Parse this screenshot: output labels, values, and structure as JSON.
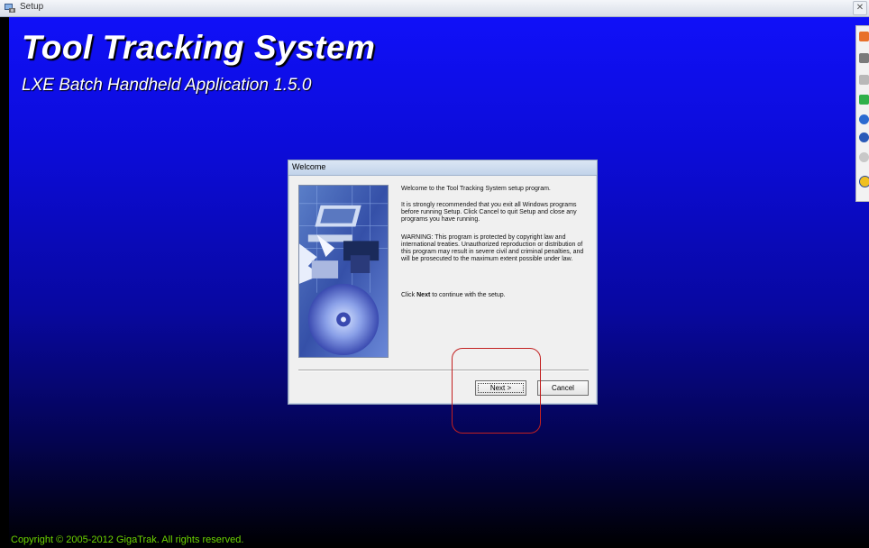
{
  "window": {
    "title": "Setup",
    "close_glyph": "✕"
  },
  "banner": {
    "title": "Tool Tracking System",
    "subtitle": "LXE Batch Handheld Application 1.5.0"
  },
  "copyright": "Copyright © 2005-2012 GigaTrak. All rights reserved.",
  "dialog": {
    "title": "Welcome",
    "intro": "Welcome to the Tool Tracking System setup program.",
    "recommend": "It is strongly recommended that you exit all Windows programs before running Setup.  Click Cancel to quit Setup and close any programs you have running.",
    "warning": "WARNING: This program is protected by copyright law and international treaties.  Unauthorized reproduction or distribution of this program may result in severe civil and criminal penalties, and will be prosecuted to the maximum extent possible under law.",
    "continue_prefix": "Click ",
    "continue_bold": "Next",
    "continue_suffix": " to continue with the setup.",
    "next_label": "Next >",
    "cancel_label": "Cancel"
  },
  "toolbar_icons": [
    "orange-icon",
    "gray-icon",
    "gray-icon",
    "green-icon",
    "blue-icon",
    "blue-icon",
    "gray-icon",
    "yellow-icon"
  ],
  "colors": {
    "copyright": "#6cd400",
    "annotation": "#c22020"
  }
}
